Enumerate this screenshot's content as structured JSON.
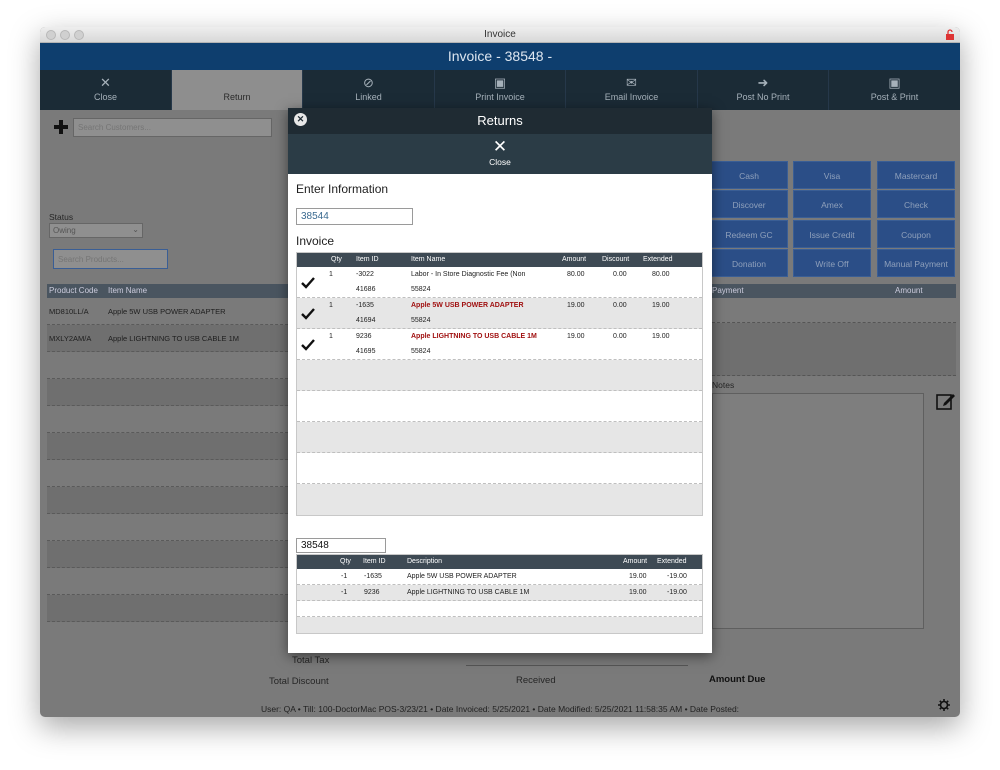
{
  "window": {
    "title": "Invoice"
  },
  "header": {
    "title": "Invoice - 38548 -"
  },
  "toolbar": {
    "items": [
      {
        "label": "Close",
        "icon": "close-icon"
      },
      {
        "label": "Return",
        "icon": "return-icon"
      },
      {
        "label": "Linked",
        "icon": "link-icon"
      },
      {
        "label": "Print Invoice",
        "icon": "printer-icon"
      },
      {
        "label": "Email Invoice",
        "icon": "mail-icon"
      },
      {
        "label": "Post No Print",
        "icon": "arrow-right-icon"
      },
      {
        "label": "Post & Print",
        "icon": "printer-icon"
      }
    ]
  },
  "customer": {
    "search_placeholder": "Search Customers..."
  },
  "status": {
    "label": "Status",
    "value": "Owing"
  },
  "products": {
    "search_placeholder": "Search Products...",
    "columns": [
      "Product Code",
      "Item Name"
    ],
    "rows": [
      {
        "code": "MD810LL/A",
        "name": "Apple 5W USB POWER ADAPTER"
      },
      {
        "code": "MXLY2AM/A",
        "name": "Apple LIGHTNING TO USB CABLE 1M"
      }
    ]
  },
  "payments": {
    "buttons": [
      "Cash",
      "Visa",
      "Mastercard",
      "Discover",
      "Amex",
      "Check",
      "Redeem GC",
      "Issue Credit",
      "Coupon",
      "Donation",
      "Write Off",
      "Manual Payment"
    ],
    "columns": [
      "Payment",
      "Amount"
    ],
    "notes_label": "Notes"
  },
  "totals": {
    "total_tax": "Total Tax",
    "total_discount": "Total Discount",
    "received": "Received",
    "amount_due": "Amount Due"
  },
  "statusbar": {
    "text": "User: QA • Till: 100-DoctorMac POS-3/23/21 • Date Invoiced: 5/25/2021 • Date Modified: 5/25/2021 11:58:35 AM • Date Posted:"
  },
  "modal": {
    "title": "Returns",
    "close_label": "Close",
    "enter_info_label": "Enter Information",
    "search_value": "38544",
    "invoice_label": "Invoice",
    "invoice_table": {
      "columns": [
        "Qty",
        "Item ID",
        "Item Name",
        "Amount",
        "Discount",
        "Extended"
      ],
      "rows": [
        {
          "checked": true,
          "qty": "1",
          "item_id": "-3022",
          "item_id2": "41686",
          "name": "Labor - In Store Diagnostic Fee (Non",
          "name2": "55824",
          "amount": "80.00",
          "discount": "0.00",
          "extended": "80.00",
          "highlight": false
        },
        {
          "checked": true,
          "qty": "1",
          "item_id": "-1635",
          "item_id2": "41694",
          "name": "Apple 5W USB POWER ADAPTER",
          "name2": "55824",
          "amount": "19.00",
          "discount": "0.00",
          "extended": "19.00",
          "highlight": true
        },
        {
          "checked": true,
          "qty": "1",
          "item_id": "9236",
          "item_id2": "41695",
          "name": "Apple LIGHTNING TO USB CABLE 1M",
          "name2": "55824",
          "amount": "19.00",
          "discount": "0.00",
          "extended": "19.00",
          "highlight": true
        }
      ]
    },
    "return_invoice_value": "38548",
    "return_table": {
      "columns": [
        "Qty",
        "Item ID",
        "Description",
        "Amount",
        "Extended"
      ],
      "rows": [
        {
          "qty": "-1",
          "item_id": "-1635",
          "description": "Apple 5W USB POWER ADAPTER",
          "amount": "19.00",
          "extended": "-19.00"
        },
        {
          "qty": "-1",
          "item_id": "9236",
          "description": "Apple LIGHTNING TO USB CABLE 1M",
          "amount": "19.00",
          "extended": "-19.00"
        }
      ]
    }
  },
  "colors": {
    "header": "#0e3e6e",
    "toolbar": "#1b2b36",
    "payment_button": "#2b4e87",
    "highlight_text": "#a01010"
  }
}
